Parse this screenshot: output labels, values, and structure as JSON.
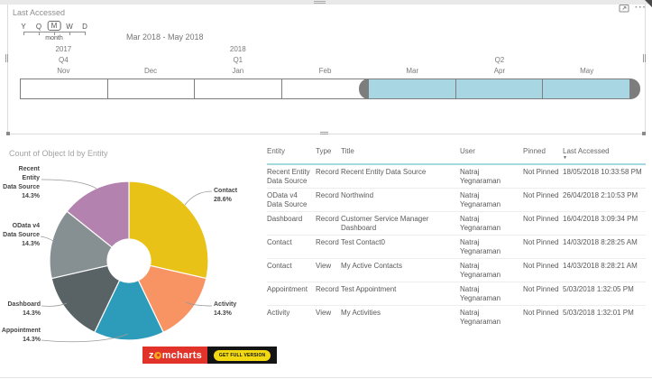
{
  "visual_header": {
    "more_options": "···"
  },
  "timeline": {
    "title": "Last Accessed",
    "periods": [
      {
        "key": "Y",
        "selected": false
      },
      {
        "key": "Q",
        "selected": false
      },
      {
        "key": "M",
        "selected": true
      },
      {
        "key": "W",
        "selected": false
      },
      {
        "key": "D",
        "selected": false
      }
    ],
    "selected_period_label": "month",
    "range_label": "Mar 2018 - May 2018",
    "years": [
      {
        "label": "2017",
        "col": 0
      },
      {
        "label": "2018",
        "col": 2
      }
    ],
    "quarters": [
      {
        "label": "Q4",
        "col": 0
      },
      {
        "label": "Q1",
        "col": 2
      },
      {
        "label": "Q2",
        "col": 5
      }
    ],
    "months": [
      {
        "label": "Nov",
        "selected": false
      },
      {
        "label": "Dec",
        "selected": false
      },
      {
        "label": "Jan",
        "selected": false
      },
      {
        "label": "Feb",
        "selected": false
      },
      {
        "label": "Mar",
        "selected": true
      },
      {
        "label": "Apr",
        "selected": true
      },
      {
        "label": "May",
        "selected": true
      }
    ],
    "selection_color": "#a9d6e3",
    "handle_color": "#7d7d7d"
  },
  "chart_data": {
    "type": "pie",
    "subtype": "donut",
    "title": "Count of Object Id by Entity",
    "direction": "clockwise",
    "start_angle_deg": 0,
    "slices": [
      {
        "label": "Contact",
        "pct": 28.6,
        "pct_label": "28.6%",
        "label_lines": [
          "Contact"
        ],
        "color": "#e9c217"
      },
      {
        "label": "Activity",
        "pct": 14.3,
        "pct_label": "14.3%",
        "label_lines": [
          "Activity"
        ],
        "color": "#f89463"
      },
      {
        "label": "Appointment",
        "pct": 14.3,
        "pct_label": "14.3%",
        "label_lines": [
          "Appointment"
        ],
        "color": "#2d9cba"
      },
      {
        "label": "Dashboard",
        "pct": 14.3,
        "pct_label": "14.3%",
        "label_lines": [
          "Dashboard"
        ],
        "color": "#596365"
      },
      {
        "label": "OData v4 Data Source",
        "pct": 14.3,
        "pct_label": "14.3%",
        "label_lines": [
          "OData v4",
          "Data Source"
        ],
        "color": "#869092"
      },
      {
        "label": "Recent Entity Data Source",
        "pct": 14.3,
        "pct_label": "14.3%",
        "label_lines": [
          "Recent Entity",
          "Data Source"
        ],
        "color": "#b382ae"
      }
    ]
  },
  "branding": {
    "logo_prefix": "z",
    "logo_suffix": "mcharts",
    "button_label": "GET FULL VERSION",
    "logo_bg": "#e2332a",
    "button_bg": "#f3d911"
  },
  "table": {
    "columns": [
      {
        "label": "Entity",
        "sorted": false
      },
      {
        "label": "Type",
        "sorted": false
      },
      {
        "label": "Title",
        "sorted": false
      },
      {
        "label": "User",
        "sorted": false
      },
      {
        "label": "Pinned",
        "sorted": false
      },
      {
        "label": "Last Accessed",
        "sorted": true
      }
    ],
    "sort_icon": "▼",
    "rows": [
      {
        "entity": "Recent Entity Data Source",
        "type": "Record",
        "title": "Recent Entity Data Source",
        "user": "Natraj Yegnaraman",
        "pinned": "Not Pinned",
        "last_accessed": "18/05/2018 10:33:58 PM"
      },
      {
        "entity": "OData v4 Data Source",
        "type": "Record",
        "title": "Northwind",
        "user": "Natraj Yegnaraman",
        "pinned": "Not Pinned",
        "last_accessed": "26/04/2018 2:10:53 PM"
      },
      {
        "entity": "Dashboard",
        "type": "Record",
        "title": "Customer Service Manager Dashboard",
        "user": "Natraj Yegnaraman",
        "pinned": "Not Pinned",
        "last_accessed": "16/04/2018 3:09:34 PM"
      },
      {
        "entity": "Contact",
        "type": "Record",
        "title": "Test Contact0",
        "user": "Natraj Yegnaraman",
        "pinned": "Not Pinned",
        "last_accessed": "14/03/2018 8:28:25 AM"
      },
      {
        "entity": "Contact",
        "type": "View",
        "title": "My Active Contacts",
        "user": "Natraj Yegnaraman",
        "pinned": "Not Pinned",
        "last_accessed": "14/03/2018 8:28:21 AM"
      },
      {
        "entity": "Appointment",
        "type": "Record",
        "title": "Test Appointment",
        "user": "Natraj Yegnaraman",
        "pinned": "Not Pinned",
        "last_accessed": "5/03/2018 1:32:05 PM"
      },
      {
        "entity": "Activity",
        "type": "View",
        "title": "My Activities",
        "user": "Natraj Yegnaraman",
        "pinned": "Not Pinned",
        "last_accessed": "5/03/2018 1:32:01 PM"
      }
    ]
  }
}
